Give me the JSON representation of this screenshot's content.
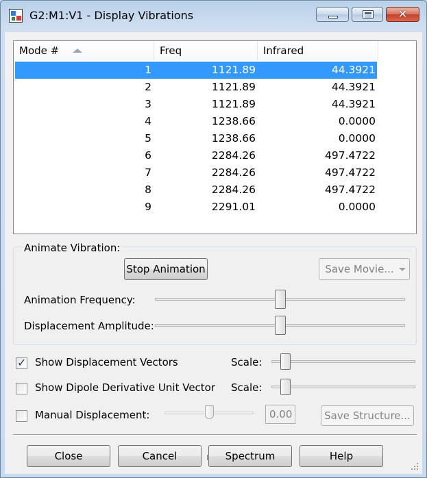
{
  "window": {
    "title": "G2:M1:V1 - Display Vibrations"
  },
  "table": {
    "columns": [
      "Mode #",
      "Freq",
      "Infrared"
    ],
    "rows": [
      {
        "mode": "1",
        "freq": "1121.89",
        "ir": "44.3921"
      },
      {
        "mode": "2",
        "freq": "1121.89",
        "ir": "44.3921"
      },
      {
        "mode": "3",
        "freq": "1121.89",
        "ir": "44.3921"
      },
      {
        "mode": "4",
        "freq": "1238.66",
        "ir": "0.0000"
      },
      {
        "mode": "5",
        "freq": "1238.66",
        "ir": "0.0000"
      },
      {
        "mode": "6",
        "freq": "2284.26",
        "ir": "497.4722"
      },
      {
        "mode": "7",
        "freq": "2284.26",
        "ir": "497.4722"
      },
      {
        "mode": "8",
        "freq": "2284.26",
        "ir": "497.4722"
      },
      {
        "mode": "9",
        "freq": "2291.01",
        "ir": "0.0000"
      }
    ],
    "selected_row": 1
  },
  "animate": {
    "group_label": "Animate Vibration:",
    "stop_label": "Stop Animation",
    "save_movie_label": "Save Movie...",
    "freq_label": "Animation Frequency:",
    "freq_value": 0.5,
    "amp_label": "Displacement Amplitude:",
    "amp_value": 0.5
  },
  "options": {
    "show_vectors_label": "Show Displacement Vectors",
    "show_vectors_checked": true,
    "show_dipole_label": "Show Dipole Derivative Unit Vector",
    "show_dipole_checked": false,
    "manual_label": "Manual Displacement:",
    "manual_checked": false,
    "scale_label": "Scale:",
    "manual_value": "0.00",
    "save_structure_label": "Save Structure..."
  },
  "buttons": {
    "close": "Close",
    "cancel": "Cancel",
    "spectrum": "Spectrum",
    "help": "Help"
  }
}
